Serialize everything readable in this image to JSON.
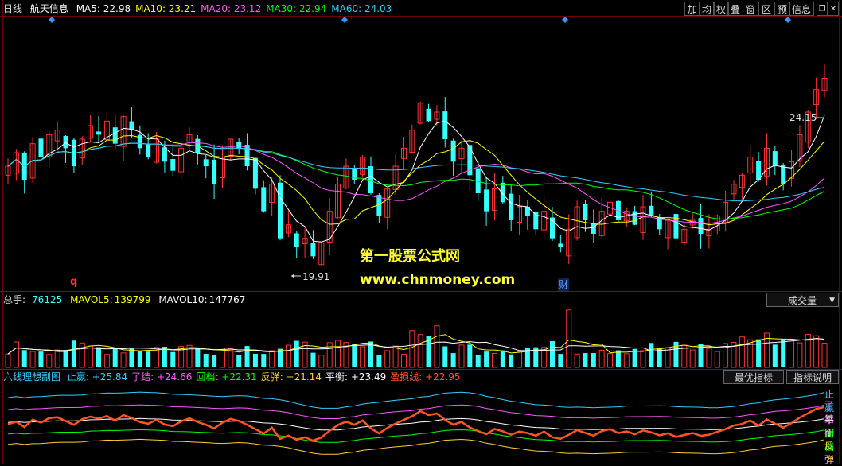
{
  "header": {
    "period": "日线",
    "stock_name": "航天信息",
    "ma": [
      {
        "label": "MA5: 22.98",
        "color": "#ffffff"
      },
      {
        "label": "MA10: 23.21",
        "color": "#ffff00"
      },
      {
        "label": "MA20: 23.12",
        "color": "#ff55ff"
      },
      {
        "label": "MA30: 22.94",
        "color": "#00ff00"
      },
      {
        "label": "MA60: 24.03",
        "color": "#33ccff"
      }
    ],
    "toolbar": [
      "加",
      "均",
      "权",
      "叠",
      "窗",
      "区",
      "预"
    ],
    "info_button": "信息"
  },
  "price_pane": {
    "high_label": "24.15",
    "low_label": "19.91",
    "event_q": "q",
    "event_cai": "财",
    "watermark_text": "第一股票公式网",
    "watermark_url": "www.chnmoney.com"
  },
  "volume_pane": {
    "label_total": "总手:",
    "total": "76125",
    "label_mavol5": "MAVOL5:",
    "mavol5": "139799",
    "label_mavol10": "MAVOL10:",
    "mavol10": "147767",
    "selector": "成交量"
  },
  "indicator_pane": {
    "name": "六线理想副图",
    "values": [
      {
        "label": "止赢: +25.84",
        "color": "#33ccff"
      },
      {
        "label": "了结: +24.66",
        "color": "#ff55ff"
      },
      {
        "label": "回档: +22.31",
        "color": "#00ff00"
      },
      {
        "label": "反弹: +21.14",
        "color": "#ffcc33"
      },
      {
        "label": "平衡: +23.49",
        "color": "#ffffff"
      },
      {
        "label": "盈损线: +22.95",
        "color": "#ff5522"
      }
    ],
    "right_labels": [
      {
        "text": "止赢",
        "color": "#33ccff"
      },
      {
        "text": "了结",
        "color": "#ff55ff"
      },
      {
        "text": "平衡",
        "color": "#ffffff"
      },
      {
        "text": "回档",
        "color": "#00ff00"
      },
      {
        "text": "反弹",
        "color": "#ffcc33"
      }
    ],
    "button_best": "最优指标",
    "button_help": "指标说明"
  },
  "chart_data": [
    {
      "type": "candlestick",
      "title": "航天信息",
      "series_names": [
        "MA5",
        "MA10",
        "MA20",
        "MA30",
        "MA60"
      ],
      "ylim": [
        19.5,
        25.5
      ],
      "price_high": 24.15,
      "price_low": 19.91,
      "colors": {
        "up": "#ff3333",
        "down": "#33ffff",
        "ma5": "#ffffff",
        "ma10": "#ffff00",
        "ma20": "#ff55ff",
        "ma30": "#00ff00",
        "ma60": "#33ccff"
      },
      "closes": [
        22.2,
        22.5,
        21.9,
        22.7,
        22.4,
        22.9,
        23.0,
        22.6,
        22.2,
        22.8,
        23.1,
        22.9,
        23.2,
        22.7,
        23.3,
        23.0,
        22.6,
        22.4,
        22.8,
        22.3,
        22.1,
        22.6,
        22.9,
        22.5,
        22.2,
        21.8,
        22.4,
        22.8,
        22.6,
        22.2,
        21.7,
        21.2,
        21.8,
        20.6,
        20.9,
        20.4,
        20.6,
        20.2,
        20.5,
        21.2,
        21.8,
        22.2,
        21.9,
        22.4,
        21.6,
        21.1,
        21.7,
        22.2,
        22.6,
        23.0,
        23.6,
        23.2,
        23.4,
        22.8,
        22.3,
        22.6,
        22.0,
        21.6,
        21.2,
        21.7,
        21.4,
        21.0,
        21.3,
        21.1,
        20.8,
        21.2,
        20.6,
        20.4,
        20.8,
        21.3,
        21.0,
        20.7,
        21.2,
        21.4,
        21.0,
        21.2,
        20.9,
        21.3,
        21.1,
        20.8,
        21.0,
        20.6,
        20.8,
        21.0,
        20.7,
        20.8,
        21.1,
        21.4,
        21.8,
        22.0,
        22.4,
        21.9,
        22.6,
        22.2,
        21.8,
        22.3,
        22.9,
        23.4,
        23.9,
        24.15
      ],
      "volume": {
        "series_names": [
          "MAVOL5",
          "MAVOL10"
        ],
        "total": 76125,
        "mavol5": 139799,
        "mavol10": 147767
      },
      "indicator": {
        "name": "六线理想副图",
        "series_names": [
          "止赢",
          "了结",
          "平衡",
          "盈损线",
          "回档",
          "反弹"
        ],
        "last_values": {
          "止赢": 25.84,
          "了结": 24.66,
          "回档": 22.31,
          "反弹": 21.14,
          "平衡": 23.49,
          "盈损线": 22.95
        }
      }
    }
  ]
}
